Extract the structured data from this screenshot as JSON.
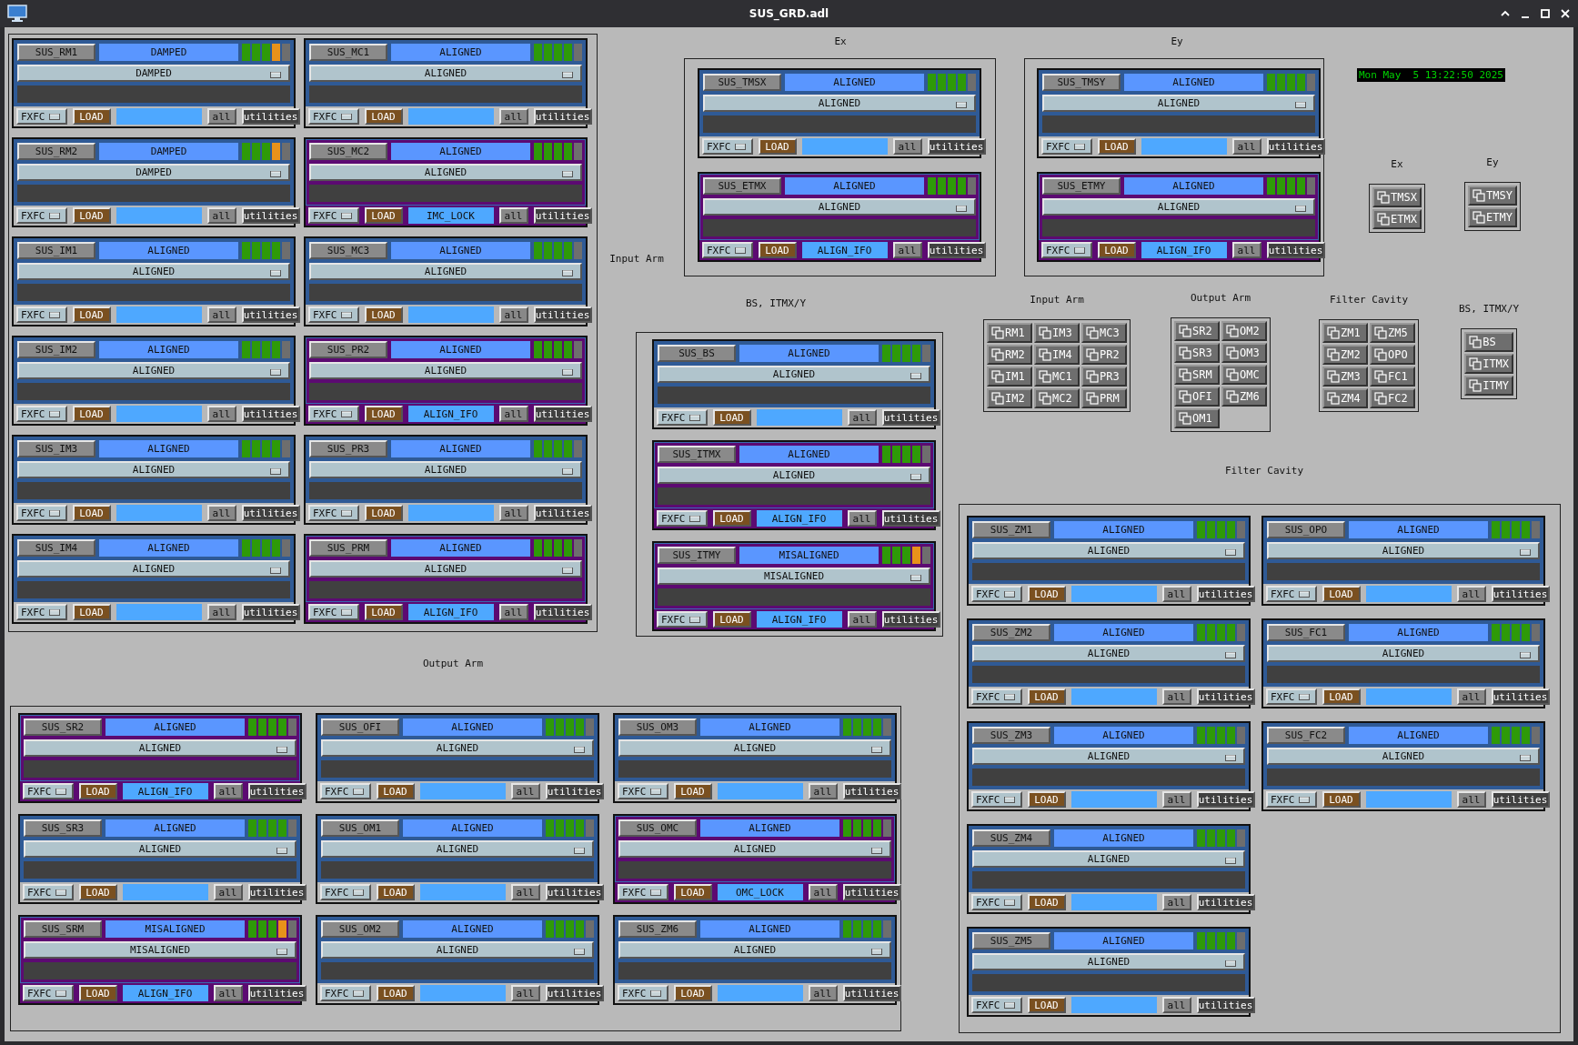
{
  "window": {
    "title": "SUS_GRD.adl"
  },
  "clock": "Mon May  5 13:22:50 2025",
  "groups": [
    {
      "label": "Input Arm",
      "panels": [
        {
          "name": "SUS_RM1",
          "state": "DAMPED",
          "request": "DAMPED",
          "managed": false,
          "indicators": [
            {
              "color": "#2e9a08"
            },
            {
              "color": "#2e9a08"
            },
            {
              "color": "#2e9a08"
            },
            {
              "color": "#e8921a"
            },
            {
              "color": "#6e6e6e"
            }
          ],
          "fxfc": "FXFC",
          "load": "LOAD",
          "all": "all",
          "utilities": "utilities"
        },
        {
          "name": "SUS_MC1",
          "state": "ALIGNED",
          "request": "ALIGNED",
          "managed": false,
          "indicators": [
            {
              "color": "#2e9a08"
            },
            {
              "color": "#2e9a08"
            },
            {
              "color": "#2e9a08"
            },
            {
              "color": "#2e9a08"
            },
            {
              "color": "#6e6e6e"
            }
          ],
          "fxfc": "FXFC",
          "load": "LOAD",
          "all": "all",
          "utilities": "utilities"
        },
        {
          "name": "SUS_RM2",
          "state": "DAMPED",
          "request": "DAMPED",
          "managed": false,
          "indicators": [
            {
              "color": "#2e9a08"
            },
            {
              "color": "#2e9a08"
            },
            {
              "color": "#2e9a08"
            },
            {
              "color": "#e8921a"
            },
            {
              "color": "#6e6e6e"
            }
          ],
          "fxfc": "FXFC",
          "load": "LOAD",
          "all": "all",
          "utilities": "utilities"
        },
        {
          "name": "SUS_MC2",
          "state": "ALIGNED",
          "request": "ALIGNED",
          "managed": true,
          "manager": "IMC_LOCK",
          "indicators": [
            {
              "color": "#2e9a08"
            },
            {
              "color": "#2e9a08"
            },
            {
              "color": "#2e9a08"
            },
            {
              "color": "#2e9a08"
            },
            {
              "color": "#6e6e6e"
            }
          ],
          "fxfc": "FXFC",
          "load": "LOAD",
          "all": "all",
          "utilities": "utilities"
        },
        {
          "name": "SUS_IM1",
          "state": "ALIGNED",
          "request": "ALIGNED",
          "managed": false,
          "indicators": [
            {
              "color": "#2e9a08"
            },
            {
              "color": "#2e9a08"
            },
            {
              "color": "#2e9a08"
            },
            {
              "color": "#2e9a08"
            },
            {
              "color": "#6e6e6e"
            }
          ],
          "fxfc": "FXFC",
          "load": "LOAD",
          "all": "all",
          "utilities": "utilities"
        },
        {
          "name": "SUS_MC3",
          "state": "ALIGNED",
          "request": "ALIGNED",
          "managed": false,
          "indicators": [
            {
              "color": "#2e9a08"
            },
            {
              "color": "#2e9a08"
            },
            {
              "color": "#2e9a08"
            },
            {
              "color": "#2e9a08"
            },
            {
              "color": "#6e6e6e"
            }
          ],
          "fxfc": "FXFC",
          "load": "LOAD",
          "all": "all",
          "utilities": "utilities"
        },
        {
          "name": "SUS_IM2",
          "state": "ALIGNED",
          "request": "ALIGNED",
          "managed": false,
          "indicators": [
            {
              "color": "#2e9a08"
            },
            {
              "color": "#2e9a08"
            },
            {
              "color": "#2e9a08"
            },
            {
              "color": "#2e9a08"
            },
            {
              "color": "#6e6e6e"
            }
          ],
          "fxfc": "FXFC",
          "load": "LOAD",
          "all": "all",
          "utilities": "utilities"
        },
        {
          "name": "SUS_PR2",
          "state": "ALIGNED",
          "request": "ALIGNED",
          "managed": true,
          "manager": "ALIGN_IFO",
          "indicators": [
            {
              "color": "#2e9a08"
            },
            {
              "color": "#2e9a08"
            },
            {
              "color": "#2e9a08"
            },
            {
              "color": "#2e9a08"
            },
            {
              "color": "#6e6e6e"
            }
          ],
          "fxfc": "FXFC",
          "load": "LOAD",
          "all": "all",
          "utilities": "utilities"
        },
        {
          "name": "SUS_IM3",
          "state": "ALIGNED",
          "request": "ALIGNED",
          "managed": false,
          "indicators": [
            {
              "color": "#2e9a08"
            },
            {
              "color": "#2e9a08"
            },
            {
              "color": "#2e9a08"
            },
            {
              "color": "#2e9a08"
            },
            {
              "color": "#6e6e6e"
            }
          ],
          "fxfc": "FXFC",
          "load": "LOAD",
          "all": "all",
          "utilities": "utilities"
        },
        {
          "name": "SUS_PR3",
          "state": "ALIGNED",
          "request": "ALIGNED",
          "managed": false,
          "indicators": [
            {
              "color": "#2e9a08"
            },
            {
              "color": "#2e9a08"
            },
            {
              "color": "#2e9a08"
            },
            {
              "color": "#2e9a08"
            },
            {
              "color": "#6e6e6e"
            }
          ],
          "fxfc": "FXFC",
          "load": "LOAD",
          "all": "all",
          "utilities": "utilities"
        },
        {
          "name": "SUS_IM4",
          "state": "ALIGNED",
          "request": "ALIGNED",
          "managed": false,
          "indicators": [
            {
              "color": "#2e9a08"
            },
            {
              "color": "#2e9a08"
            },
            {
              "color": "#2e9a08"
            },
            {
              "color": "#2e9a08"
            },
            {
              "color": "#6e6e6e"
            }
          ],
          "fxfc": "FXFC",
          "load": "LOAD",
          "all": "all",
          "utilities": "utilities"
        },
        {
          "name": "SUS_PRM",
          "state": "ALIGNED",
          "request": "ALIGNED",
          "managed": true,
          "manager": "ALIGN_IFO",
          "indicators": [
            {
              "color": "#2e9a08"
            },
            {
              "color": "#2e9a08"
            },
            {
              "color": "#2e9a08"
            },
            {
              "color": "#2e9a08"
            },
            {
              "color": "#6e6e6e"
            }
          ],
          "fxfc": "FXFC",
          "load": "LOAD",
          "all": "all",
          "utilities": "utilities"
        }
      ]
    },
    {
      "label": "Ex",
      "panels": [
        {
          "name": "SUS_TMSX",
          "state": "ALIGNED",
          "request": "ALIGNED",
          "managed": false,
          "indicators": [
            {
              "color": "#2e9a08"
            },
            {
              "color": "#2e9a08"
            },
            {
              "color": "#2e9a08"
            },
            {
              "color": "#2e9a08"
            },
            {
              "color": "#6e6e6e"
            }
          ],
          "fxfc": "FXFC",
          "load": "LOAD",
          "all": "all",
          "utilities": "utilities"
        },
        {
          "name": "SUS_ETMX",
          "state": "ALIGNED",
          "request": "ALIGNED",
          "managed": true,
          "manager": "ALIGN_IFO",
          "indicators": [
            {
              "color": "#2e9a08"
            },
            {
              "color": "#2e9a08"
            },
            {
              "color": "#2e9a08"
            },
            {
              "color": "#2e9a08"
            },
            {
              "color": "#6e6e6e"
            }
          ],
          "fxfc": "FXFC",
          "load": "LOAD",
          "all": "all",
          "utilities": "utilities"
        }
      ]
    },
    {
      "label": "Ey",
      "panels": [
        {
          "name": "SUS_TMSY",
          "state": "ALIGNED",
          "request": "ALIGNED",
          "managed": false,
          "indicators": [
            {
              "color": "#2e9a08"
            },
            {
              "color": "#2e9a08"
            },
            {
              "color": "#2e9a08"
            },
            {
              "color": "#2e9a08"
            },
            {
              "color": "#6e6e6e"
            }
          ],
          "fxfc": "FXFC",
          "load": "LOAD",
          "all": "all",
          "utilities": "utilities"
        },
        {
          "name": "SUS_ETMY",
          "state": "ALIGNED",
          "request": "ALIGNED",
          "managed": true,
          "manager": "ALIGN_IFO",
          "indicators": [
            {
              "color": "#2e9a08"
            },
            {
              "color": "#2e9a08"
            },
            {
              "color": "#2e9a08"
            },
            {
              "color": "#2e9a08"
            },
            {
              "color": "#6e6e6e"
            }
          ],
          "fxfc": "FXFC",
          "load": "LOAD",
          "all": "all",
          "utilities": "utilities"
        }
      ]
    },
    {
      "label": "BS, ITMX/Y",
      "panels": [
        {
          "name": "SUS_BS",
          "state": "ALIGNED",
          "request": "ALIGNED",
          "managed": false,
          "indicators": [
            {
              "color": "#2e9a08"
            },
            {
              "color": "#2e9a08"
            },
            {
              "color": "#2e9a08"
            },
            {
              "color": "#2e9a08"
            },
            {
              "color": "#6e6e6e"
            }
          ],
          "fxfc": "FXFC",
          "load": "LOAD",
          "all": "all",
          "utilities": "utilities"
        },
        {
          "name": "SUS_ITMX",
          "state": "ALIGNED",
          "request": "ALIGNED",
          "managed": true,
          "manager": "ALIGN_IFO",
          "indicators": [
            {
              "color": "#2e9a08"
            },
            {
              "color": "#2e9a08"
            },
            {
              "color": "#2e9a08"
            },
            {
              "color": "#2e9a08"
            },
            {
              "color": "#6e6e6e"
            }
          ],
          "fxfc": "FXFC",
          "load": "LOAD",
          "all": "all",
          "utilities": "utilities"
        },
        {
          "name": "SUS_ITMY",
          "state": "MISALIGNED",
          "request": "MISALIGNED",
          "managed": true,
          "manager": "ALIGN_IFO",
          "indicators": [
            {
              "color": "#2e9a08"
            },
            {
              "color": "#2e9a08"
            },
            {
              "color": "#2e9a08"
            },
            {
              "color": "#e8921a"
            },
            {
              "color": "#6e6e6e"
            }
          ],
          "fxfc": "FXFC",
          "load": "LOAD",
          "all": "all",
          "utilities": "utilities"
        }
      ]
    },
    {
      "label": "Output Arm",
      "panels": [
        {
          "name": "SUS_SR2",
          "state": "ALIGNED",
          "request": "ALIGNED",
          "managed": true,
          "manager": "ALIGN_IFO",
          "indicators": [
            {
              "color": "#2e9a08"
            },
            {
              "color": "#2e9a08"
            },
            {
              "color": "#2e9a08"
            },
            {
              "color": "#2e9a08"
            },
            {
              "color": "#6e6e6e"
            }
          ],
          "fxfc": "FXFC",
          "load": "LOAD",
          "all": "all",
          "utilities": "utilities"
        },
        {
          "name": "SUS_OFI",
          "state": "ALIGNED",
          "request": "ALIGNED",
          "managed": false,
          "indicators": [
            {
              "color": "#2e9a08"
            },
            {
              "color": "#2e9a08"
            },
            {
              "color": "#2e9a08"
            },
            {
              "color": "#2e9a08"
            },
            {
              "color": "#6e6e6e"
            }
          ],
          "fxfc": "FXFC",
          "load": "LOAD",
          "all": "all",
          "utilities": "utilities"
        },
        {
          "name": "SUS_OM3",
          "state": "ALIGNED",
          "request": "ALIGNED",
          "managed": false,
          "indicators": [
            {
              "color": "#2e9a08"
            },
            {
              "color": "#2e9a08"
            },
            {
              "color": "#2e9a08"
            },
            {
              "color": "#2e9a08"
            },
            {
              "color": "#6e6e6e"
            }
          ],
          "fxfc": "FXFC",
          "load": "LOAD",
          "all": "all",
          "utilities": "utilities"
        },
        {
          "name": "SUS_SR3",
          "state": "ALIGNED",
          "request": "ALIGNED",
          "managed": false,
          "indicators": [
            {
              "color": "#2e9a08"
            },
            {
              "color": "#2e9a08"
            },
            {
              "color": "#2e9a08"
            },
            {
              "color": "#2e9a08"
            },
            {
              "color": "#6e6e6e"
            }
          ],
          "fxfc": "FXFC",
          "load": "LOAD",
          "all": "all",
          "utilities": "utilities"
        },
        {
          "name": "SUS_OM1",
          "state": "ALIGNED",
          "request": "ALIGNED",
          "managed": false,
          "indicators": [
            {
              "color": "#2e9a08"
            },
            {
              "color": "#2e9a08"
            },
            {
              "color": "#2e9a08"
            },
            {
              "color": "#2e9a08"
            },
            {
              "color": "#6e6e6e"
            }
          ],
          "fxfc": "FXFC",
          "load": "LOAD",
          "all": "all",
          "utilities": "utilities"
        },
        {
          "name": "SUS_OMC",
          "state": "ALIGNED",
          "request": "ALIGNED",
          "managed": true,
          "manager": "OMC_LOCK",
          "indicators": [
            {
              "color": "#2e9a08"
            },
            {
              "color": "#2e9a08"
            },
            {
              "color": "#2e9a08"
            },
            {
              "color": "#2e9a08"
            },
            {
              "color": "#6e6e6e"
            }
          ],
          "fxfc": "FXFC",
          "load": "LOAD",
          "all": "all",
          "utilities": "utilities"
        },
        {
          "name": "SUS_SRM",
          "state": "MISALIGNED",
          "request": "MISALIGNED",
          "managed": true,
          "manager": "ALIGN_IFO",
          "indicators": [
            {
              "color": "#2e9a08"
            },
            {
              "color": "#2e9a08"
            },
            {
              "color": "#2e9a08"
            },
            {
              "color": "#e8921a"
            },
            {
              "color": "#6e6e6e"
            }
          ],
          "fxfc": "FXFC",
          "load": "LOAD",
          "all": "all",
          "utilities": "utilities"
        },
        {
          "name": "SUS_OM2",
          "state": "ALIGNED",
          "request": "ALIGNED",
          "managed": false,
          "indicators": [
            {
              "color": "#2e9a08"
            },
            {
              "color": "#2e9a08"
            },
            {
              "color": "#2e9a08"
            },
            {
              "color": "#2e9a08"
            },
            {
              "color": "#6e6e6e"
            }
          ],
          "fxfc": "FXFC",
          "load": "LOAD",
          "all": "all",
          "utilities": "utilities"
        },
        {
          "name": "SUS_ZM6",
          "state": "ALIGNED",
          "request": "ALIGNED",
          "managed": false,
          "indicators": [
            {
              "color": "#2e9a08"
            },
            {
              "color": "#2e9a08"
            },
            {
              "color": "#2e9a08"
            },
            {
              "color": "#2e9a08"
            },
            {
              "color": "#6e6e6e"
            }
          ],
          "fxfc": "FXFC",
          "load": "LOAD",
          "all": "all",
          "utilities": "utilities"
        }
      ]
    },
    {
      "label": "Filter Cavity",
      "panels": [
        {
          "name": "SUS_ZM1",
          "state": "ALIGNED",
          "request": "ALIGNED",
          "managed": false,
          "indicators": [
            {
              "color": "#2e9a08"
            },
            {
              "color": "#2e9a08"
            },
            {
              "color": "#2e9a08"
            },
            {
              "color": "#2e9a08"
            },
            {
              "color": "#6e6e6e"
            }
          ],
          "fxfc": "FXFC",
          "load": "LOAD",
          "all": "all",
          "utilities": "utilities"
        },
        {
          "name": "SUS_ZM2",
          "state": "ALIGNED",
          "request": "ALIGNED",
          "managed": false,
          "indicators": [
            {
              "color": "#2e9a08"
            },
            {
              "color": "#2e9a08"
            },
            {
              "color": "#2e9a08"
            },
            {
              "color": "#2e9a08"
            },
            {
              "color": "#6e6e6e"
            }
          ],
          "fxfc": "FXFC",
          "load": "LOAD",
          "all": "all",
          "utilities": "utilities"
        },
        {
          "name": "SUS_ZM3",
          "state": "ALIGNED",
          "request": "ALIGNED",
          "managed": false,
          "indicators": [
            {
              "color": "#2e9a08"
            },
            {
              "color": "#2e9a08"
            },
            {
              "color": "#2e9a08"
            },
            {
              "color": "#2e9a08"
            },
            {
              "color": "#6e6e6e"
            }
          ],
          "fxfc": "FXFC",
          "load": "LOAD",
          "all": "all",
          "utilities": "utilities"
        },
        {
          "name": "SUS_ZM4",
          "state": "ALIGNED",
          "request": "ALIGNED",
          "managed": false,
          "indicators": [
            {
              "color": "#2e9a08"
            },
            {
              "color": "#2e9a08"
            },
            {
              "color": "#2e9a08"
            },
            {
              "color": "#2e9a08"
            },
            {
              "color": "#6e6e6e"
            }
          ],
          "fxfc": "FXFC",
          "load": "LOAD",
          "all": "all",
          "utilities": "utilities"
        },
        {
          "name": "SUS_ZM5",
          "state": "ALIGNED",
          "request": "ALIGNED",
          "managed": false,
          "indicators": [
            {
              "color": "#2e9a08"
            },
            {
              "color": "#2e9a08"
            },
            {
              "color": "#2e9a08"
            },
            {
              "color": "#2e9a08"
            },
            {
              "color": "#6e6e6e"
            }
          ],
          "fxfc": "FXFC",
          "load": "LOAD",
          "all": "all",
          "utilities": "utilities"
        },
        {
          "name": "SUS_OPO",
          "state": "ALIGNED",
          "request": "ALIGNED",
          "managed": false,
          "indicators": [
            {
              "color": "#2e9a08"
            },
            {
              "color": "#2e9a08"
            },
            {
              "color": "#2e9a08"
            },
            {
              "color": "#2e9a08"
            },
            {
              "color": "#6e6e6e"
            }
          ],
          "fxfc": "FXFC",
          "load": "LOAD",
          "all": "all",
          "utilities": "utilities"
        },
        {
          "name": "SUS_FC1",
          "state": "ALIGNED",
          "request": "ALIGNED",
          "managed": false,
          "indicators": [
            {
              "color": "#2e9a08"
            },
            {
              "color": "#2e9a08"
            },
            {
              "color": "#2e9a08"
            },
            {
              "color": "#2e9a08"
            },
            {
              "color": "#6e6e6e"
            }
          ],
          "fxfc": "FXFC",
          "load": "LOAD",
          "all": "all",
          "utilities": "utilities"
        },
        {
          "name": "SUS_FC2",
          "state": "ALIGNED",
          "request": "ALIGNED",
          "managed": false,
          "indicators": [
            {
              "color": "#2e9a08"
            },
            {
              "color": "#2e9a08"
            },
            {
              "color": "#2e9a08"
            },
            {
              "color": "#2e9a08"
            },
            {
              "color": "#6e6e6e"
            }
          ],
          "fxfc": "FXFC",
          "load": "LOAD",
          "all": "all",
          "utilities": "utilities"
        }
      ]
    }
  ],
  "nav": [
    {
      "label": "Ex",
      "buttons": [
        "TMSX",
        "ETMX"
      ]
    },
    {
      "label": "Ey",
      "buttons": [
        "TMSY",
        "ETMY"
      ]
    },
    {
      "label": "Input Arm",
      "buttons": [
        "RM1",
        "IM3",
        "MC3",
        "RM2",
        "IM4",
        "PR2",
        "IM1",
        "MC1",
        "PR3",
        "IM2",
        "MC2",
        "PRM"
      ]
    },
    {
      "label": "Output Arm",
      "buttons": [
        "SR2",
        "OM2",
        "SR3",
        "OM3",
        "SRM",
        "OMC",
        "OFI",
        "ZM6",
        "OM1"
      ]
    },
    {
      "label": "Filter Cavity",
      "buttons": [
        "ZM1",
        "ZM5",
        "ZM2",
        "OPO",
        "ZM3",
        "FC1",
        "ZM4",
        "FC2"
      ]
    },
    {
      "label": "BS, ITMX/Y",
      "buttons": [
        "BS",
        "ITMX",
        "ITMY"
      ]
    }
  ]
}
